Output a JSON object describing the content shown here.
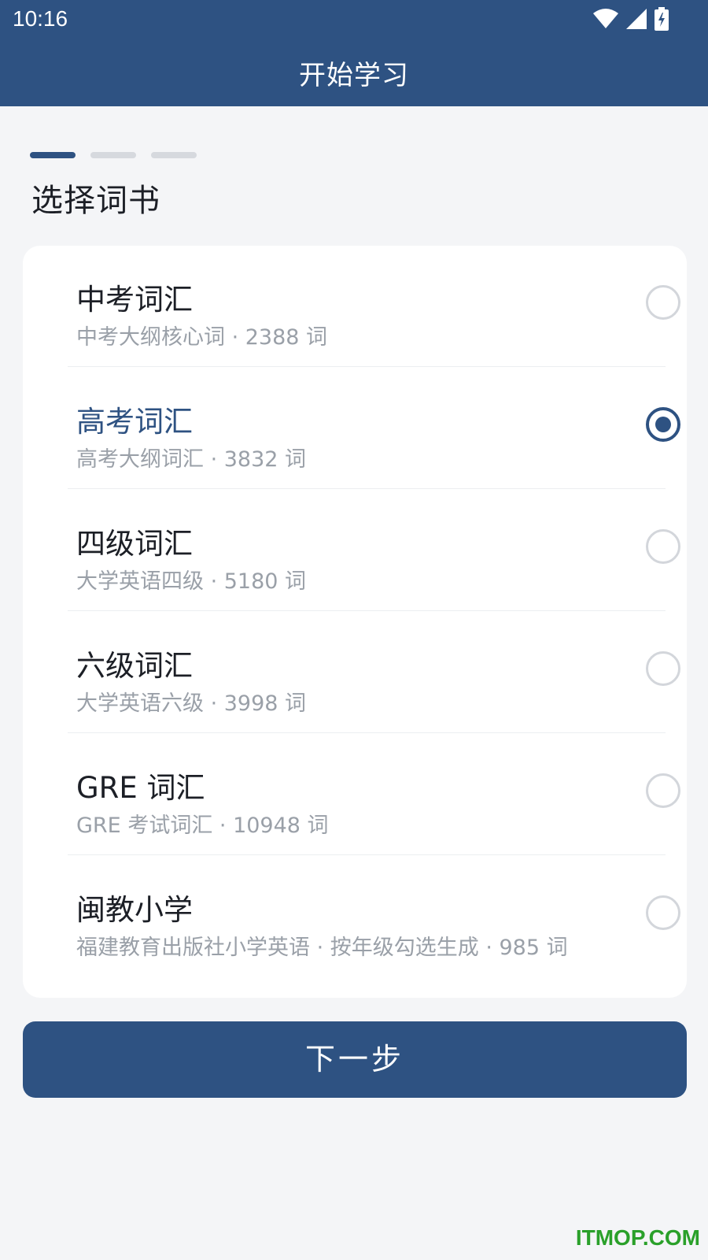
{
  "status_bar": {
    "time": "10:16",
    "icons": [
      "wifi-icon",
      "signal-icon",
      "battery-charging-icon"
    ]
  },
  "header": {
    "title": "开始学习"
  },
  "progress": {
    "total_steps": 3,
    "current_step": 1
  },
  "section_title": "选择词书",
  "options": [
    {
      "title": "中考词汇",
      "subtitle": "中考大纲核心词 · 2388 词",
      "selected": false
    },
    {
      "title": "高考词汇",
      "subtitle": "高考大纲词汇 · 3832 词",
      "selected": true
    },
    {
      "title": "四级词汇",
      "subtitle": "大学英语四级 · 5180 词",
      "selected": false
    },
    {
      "title": "六级词汇",
      "subtitle": "大学英语六级 · 3998 词",
      "selected": false
    },
    {
      "title": "GRE 词汇",
      "subtitle": "GRE 考试词汇 · 10948 词",
      "selected": false
    },
    {
      "title": "闽教小学",
      "subtitle": "福建教育出版社小学英语 · 按年级勾选生成 · 985 词",
      "selected": false
    }
  ],
  "next_button_label": "下一步",
  "watermark": "ITMOP.COM",
  "colors": {
    "primary": "#2e5282",
    "background": "#f4f5f7",
    "muted_text": "#9aa0a8",
    "radio_border": "#d3d6db"
  }
}
